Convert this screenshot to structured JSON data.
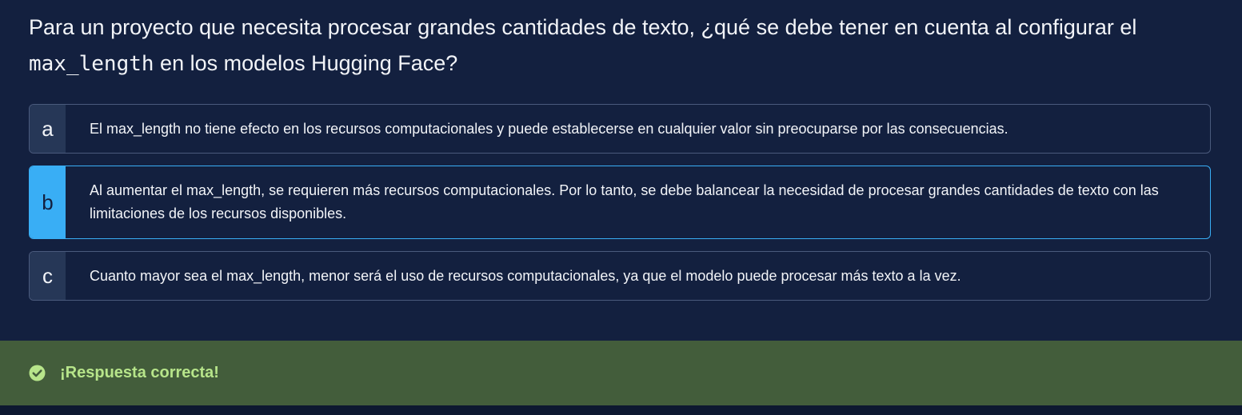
{
  "question": {
    "text_before": "Para un proyecto que necesita procesar grandes cantidades de texto, ¿qué se debe tener en cuenta al configurar el ",
    "code": "max_length",
    "text_after": " en los modelos Hugging Face?"
  },
  "options": [
    {
      "letter": "a",
      "text": "El max_length no tiene efecto en los recursos computacionales y puede establecerse en cualquier valor sin preocuparse por las consecuencias.",
      "selected": false
    },
    {
      "letter": "b",
      "text": "Al aumentar el max_length, se requieren más recursos computacionales. Por lo tanto, se debe balancear la necesidad de procesar grandes cantidades de texto con las limitaciones de los recursos disponibles.",
      "selected": true
    },
    {
      "letter": "c",
      "text": "Cuanto mayor sea el max_length, menor será el uso de recursos computacionales, ya que el modelo puede procesar más texto a la vez.",
      "selected": false
    }
  ],
  "feedback": {
    "icon": "check-circle-icon",
    "message": "¡Respuesta correcta!"
  },
  "colors": {
    "background": "#13203f",
    "selected_accent": "#39aef5",
    "feedback_bg": "#435d3b",
    "feedback_text": "#b7e58a"
  }
}
